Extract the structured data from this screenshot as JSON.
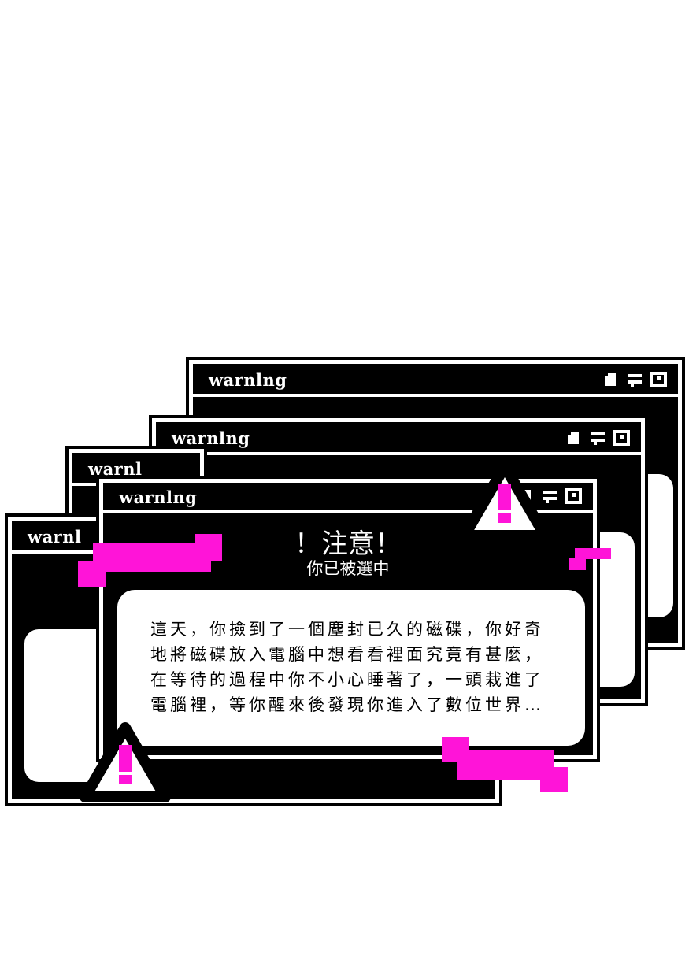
{
  "windows": [
    {
      "title": "warnlng"
    },
    {
      "title": "warnlng"
    },
    {
      "title": "warnl"
    },
    {
      "title": "warnlng"
    },
    {
      "title": "warnl"
    }
  ],
  "dialog": {
    "heading": "！注意！",
    "subheading": "你已被選中",
    "lines": [
      "這天，你撿到了一個塵封已久的磁碟，你好奇",
      "地將磁碟放入電腦中想看看裡面究竟有甚麼，",
      "在等待的過程中你不小心睡著了，一頭栽進了",
      "電腦裡，等你醒來後發現你進入了數位世界…"
    ]
  },
  "icons": {
    "title_controls": [
      "minimize-icon",
      "restore-icon",
      "maximize-icon"
    ],
    "alerts": [
      "warning-triangle-icon",
      "warning-triangle-icon"
    ]
  },
  "colors": {
    "accent": "#ff14d8",
    "frame": "#000000",
    "panel": "#ffffff"
  }
}
